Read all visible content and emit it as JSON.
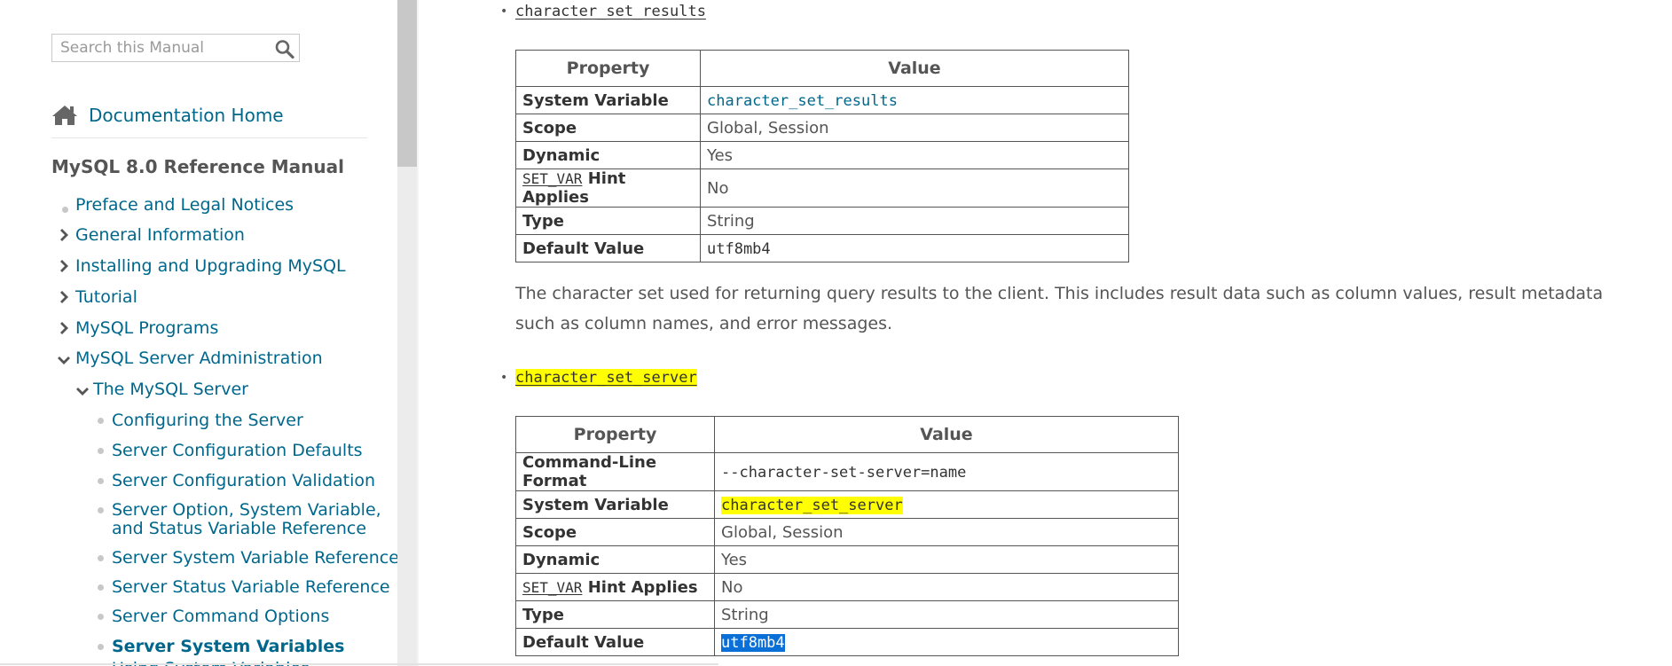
{
  "sidebar": {
    "search": {
      "placeholder": "Search this Manual"
    },
    "doc_home": "Documentation Home",
    "manual_title": "MySQL 8.0 Reference Manual",
    "items": [
      "Preface and Legal Notices",
      "General Information",
      "Installing and Upgrading MySQL",
      "Tutorial",
      "MySQL Programs",
      "MySQL Server Administration",
      "The MySQL Server",
      "Configuring the Server",
      "Server Configuration Defaults",
      "Server Configuration Validation",
      "Server Option, System Variable,",
      "and Status Variable Reference",
      "Server System Variable Reference",
      "Server Status Variable Reference",
      "Server Command Options",
      "Server System Variables",
      "Using System Variables"
    ]
  },
  "sections": [
    {
      "title": "character_set_results",
      "table": {
        "headers": [
          "Property",
          "Value"
        ],
        "rows": {
          "system_variable": {
            "key": "System Variable",
            "value": "character_set_results"
          },
          "scope": {
            "key": "Scope",
            "value": "Global, Session"
          },
          "dynamic": {
            "key": "Dynamic",
            "value": "Yes"
          },
          "hint": {
            "code": "SET_VAR",
            "key": " Hint Applies",
            "value": "No"
          },
          "type": {
            "key": "Type",
            "value": "String"
          },
          "default": {
            "key": "Default Value",
            "value": "utf8mb4"
          }
        }
      },
      "description": "The character set used for returning query results to the client. This includes result data such as column values, result metadata such as column names, and error messages."
    },
    {
      "title": "character_set_server",
      "table": {
        "headers": [
          "Property",
          "Value"
        ],
        "rows": {
          "cmdline": {
            "key": "Command-Line Format",
            "value": "--character-set-server=name"
          },
          "system_variable": {
            "key": "System Variable",
            "value": "character_set_server"
          },
          "scope": {
            "key": "Scope",
            "value": "Global, Session"
          },
          "dynamic": {
            "key": "Dynamic",
            "value": "Yes"
          },
          "hint": {
            "code": "SET_VAR",
            "key": " Hint Applies",
            "value": "No"
          },
          "type": {
            "key": "Type",
            "value": "String"
          },
          "default": {
            "key": "Default Value",
            "value": "utf8mb4"
          }
        }
      }
    }
  ],
  "colors": {
    "link": "#00678c",
    "highlight": "#ffff00",
    "selection": "#0a6fd6"
  }
}
